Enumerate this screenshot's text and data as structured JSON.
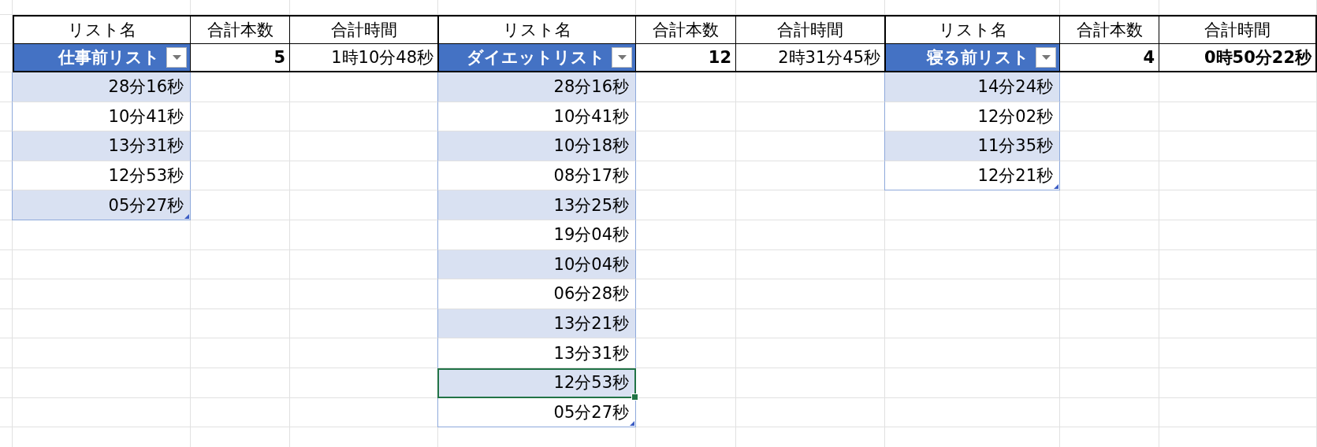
{
  "blocks": [
    {
      "headers": [
        "リスト名",
        "合計本数",
        "合計時間"
      ],
      "list_name": "仕事前リスト",
      "count": {
        "text": "5",
        "bold": true
      },
      "total": {
        "text": "1時10分48秒",
        "bold": false
      },
      "items": [
        {
          "time": "28分16秒",
          "selected": false
        },
        {
          "time": "10分41秒",
          "selected": false
        },
        {
          "time": "13分31秒",
          "selected": false
        },
        {
          "time": "12分53秒",
          "selected": false
        },
        {
          "time": "05分27秒",
          "selected": false
        }
      ]
    },
    {
      "headers": [
        "リスト名",
        "合計本数",
        "合計時間"
      ],
      "list_name": "ダイエットリスト",
      "count": {
        "text": "12",
        "bold": true
      },
      "total": {
        "text": "2時31分45秒",
        "bold": false
      },
      "items": [
        {
          "time": "28分16秒",
          "selected": false
        },
        {
          "time": "10分41秒",
          "selected": false
        },
        {
          "time": "10分18秒",
          "selected": false
        },
        {
          "time": "08分17秒",
          "selected": false
        },
        {
          "time": "13分25秒",
          "selected": false
        },
        {
          "time": "19分04秒",
          "selected": false
        },
        {
          "time": "10分04秒",
          "selected": false
        },
        {
          "time": "06分28秒",
          "selected": false
        },
        {
          "time": "13分21秒",
          "selected": false
        },
        {
          "time": "13分31秒",
          "selected": false
        },
        {
          "time": "12分53秒",
          "selected": true
        },
        {
          "time": "05分27秒",
          "selected": false
        }
      ]
    },
    {
      "headers": [
        "リスト名",
        "合計本数",
        "合計時間"
      ],
      "list_name": "寝る前リスト",
      "count": {
        "text": "4",
        "bold": true
      },
      "total": {
        "text": "0時50分22秒",
        "bold": true
      },
      "items": [
        {
          "time": "14分24秒",
          "selected": false
        },
        {
          "time": "12分02秒",
          "selected": false
        },
        {
          "time": "11分35秒",
          "selected": false
        },
        {
          "time": "12分21秒",
          "selected": false
        }
      ]
    }
  ]
}
